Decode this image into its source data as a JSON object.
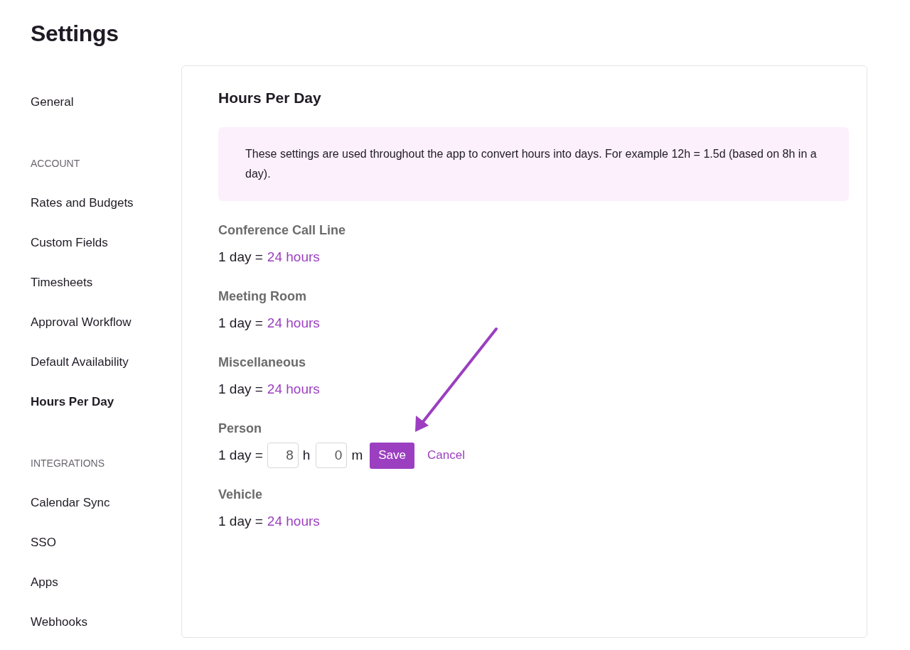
{
  "page_title": "Settings",
  "sidebar": [
    {
      "items": [
        {
          "label": "General",
          "selected": false
        }
      ]
    },
    {
      "heading": "ACCOUNT",
      "items": [
        {
          "label": "Rates and Budgets",
          "selected": false
        },
        {
          "label": "Custom Fields",
          "selected": false
        },
        {
          "label": "Timesheets",
          "selected": false
        },
        {
          "label": "Approval Workflow",
          "selected": false
        },
        {
          "label": "Default Availability",
          "selected": false
        },
        {
          "label": "Hours Per Day",
          "selected": true
        }
      ]
    },
    {
      "heading": "INTEGRATIONS",
      "items": [
        {
          "label": "Calendar Sync",
          "selected": false
        },
        {
          "label": "SSO",
          "selected": false
        },
        {
          "label": "Apps",
          "selected": false
        },
        {
          "label": "Webhooks",
          "selected": false
        }
      ]
    }
  ],
  "panel": {
    "title": "Hours Per Day",
    "info": "These settings are used throughout the app to convert hours into days. For example 12h = 1.5d (based on 8h in a day).",
    "rows": [
      {
        "kind": "display",
        "label": "Conference Call Line",
        "prefix": "1 day =",
        "value": "24 hours"
      },
      {
        "kind": "display",
        "label": "Meeting Room",
        "prefix": "1 day =",
        "value": "24 hours"
      },
      {
        "kind": "display",
        "label": "Miscellaneous",
        "prefix": "1 day =",
        "value": "24 hours"
      },
      {
        "kind": "edit",
        "label": "Person",
        "prefix": "1 day =",
        "hours": "8",
        "hours_unit": "h",
        "minutes": "0",
        "minutes_unit": "m",
        "save": "Save",
        "cancel": "Cancel"
      },
      {
        "kind": "display",
        "label": "Vehicle",
        "prefix": "1 day =",
        "value": "24 hours"
      }
    ]
  }
}
